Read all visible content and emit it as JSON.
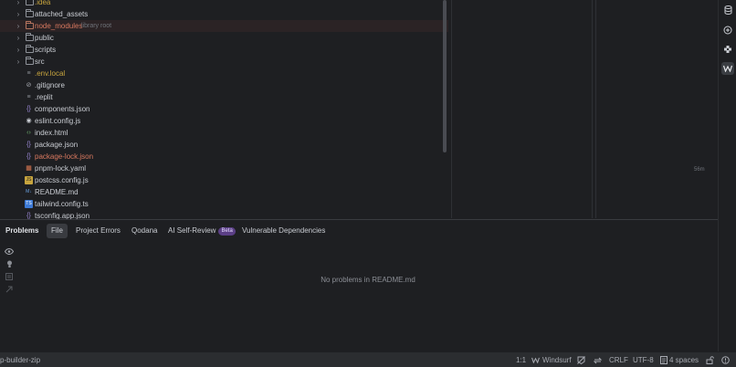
{
  "project_tree": {
    "items": [
      {
        "label": ".idea",
        "kind": "folder",
        "expandable": true,
        "color": "yellow"
      },
      {
        "label": "attached_assets",
        "kind": "folder",
        "expandable": true,
        "color": "default"
      },
      {
        "label": "node_modules",
        "hint": "library root",
        "kind": "folder-excluded",
        "expandable": true,
        "color": "red"
      },
      {
        "label": "public",
        "kind": "folder",
        "expandable": true,
        "color": "default"
      },
      {
        "label": "scripts",
        "kind": "folder",
        "expandable": true,
        "color": "default"
      },
      {
        "label": "src",
        "kind": "folder",
        "expandable": true,
        "color": "default"
      },
      {
        "label": ".env.local",
        "kind": "env-file",
        "color": "yellow"
      },
      {
        "label": ".gitignore",
        "kind": "gitignore-file",
        "color": "default"
      },
      {
        "label": ".replit",
        "kind": "text-file",
        "color": "default"
      },
      {
        "label": "components.json",
        "kind": "json-file",
        "color": "default"
      },
      {
        "label": "eslint.config.js",
        "kind": "eslint-file",
        "color": "default"
      },
      {
        "label": "index.html",
        "kind": "html-file",
        "color": "default"
      },
      {
        "label": "package.json",
        "kind": "json-file",
        "color": "default"
      },
      {
        "label": "package-lock.json",
        "kind": "json-file",
        "color": "red"
      },
      {
        "label": "pnpm-lock.yaml",
        "kind": "pnpm-file",
        "color": "default"
      },
      {
        "label": "postcss.config.js",
        "kind": "js-file",
        "color": "default"
      },
      {
        "label": "README.md",
        "kind": "markdown-file",
        "color": "default"
      },
      {
        "label": "tailwind.config.ts",
        "kind": "ts-file",
        "color": "default"
      },
      {
        "label": "tsconfig.app.json",
        "kind": "json-file",
        "color": "default"
      }
    ]
  },
  "side_panel": {
    "hint": "56m"
  },
  "problems": {
    "title": "Problems",
    "tabs": [
      {
        "label": "File",
        "active": true
      },
      {
        "label": "Project Errors",
        "active": false
      },
      {
        "label": "Qodana",
        "active": false
      },
      {
        "label": "AI Self-Review",
        "badge": "Beta",
        "active": false
      },
      {
        "label": "Vulnerable Dependencies",
        "active": false
      }
    ],
    "empty_message": "No problems in README.md"
  },
  "status_bar": {
    "project": "p-builder-zip",
    "position": "1:1",
    "windsurf": "Windsurf",
    "line_ending": "CRLF",
    "encoding": "UTF-8",
    "indent": "4 spaces"
  },
  "colors": {
    "background": "#1e1f22",
    "panel_border": "#393b40",
    "text_default": "#c9ccd2",
    "text_yellow": "#c8a53e",
    "text_red": "#d7785f",
    "beta_badge": "#5b3f86",
    "status_bar": "#2b2d30"
  }
}
